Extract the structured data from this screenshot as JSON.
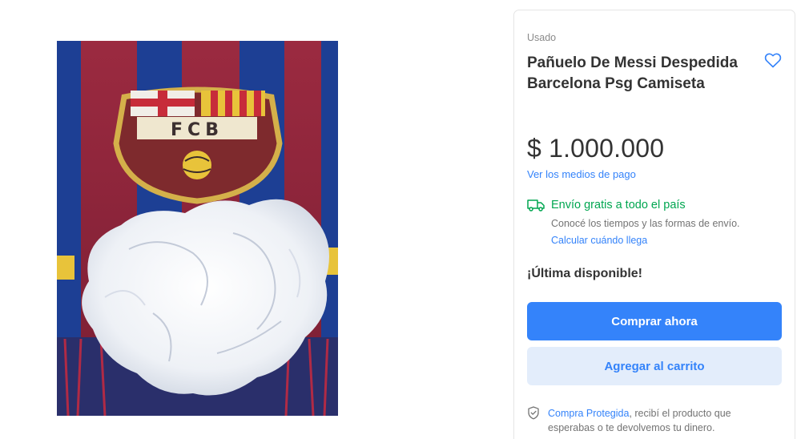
{
  "product": {
    "condition": "Usado",
    "title": "Pañuelo De Messi Despedida Barcelona Psg Camiseta",
    "price": "$ 1.000.000",
    "payment_methods_link": "Ver los medios de pago",
    "photo_crest_text": "FCB"
  },
  "shipping": {
    "title": "Envío gratis a todo el país",
    "description": "Conocé los tiempos y las formas de envío.",
    "calculate_link": "Calcular cuándo llega"
  },
  "stock": {
    "label": "¡Última disponible!"
  },
  "actions": {
    "buy_now_label": "Comprar ahora",
    "add_to_cart_label": "Agregar al carrito"
  },
  "protection": {
    "link_text": "Compra Protegida",
    "text": ", recibí el producto que esperabas o te devolvemos tu dinero."
  },
  "icons": {
    "favorite": "heart-outline-icon",
    "shipping": "truck-icon",
    "protection": "shield-check-icon"
  },
  "colors": {
    "accent": "#3483fa",
    "accent_light": "#e3edfb",
    "shipping_green": "#00a650",
    "text_primary": "#333333",
    "text_secondary": "#737373"
  }
}
